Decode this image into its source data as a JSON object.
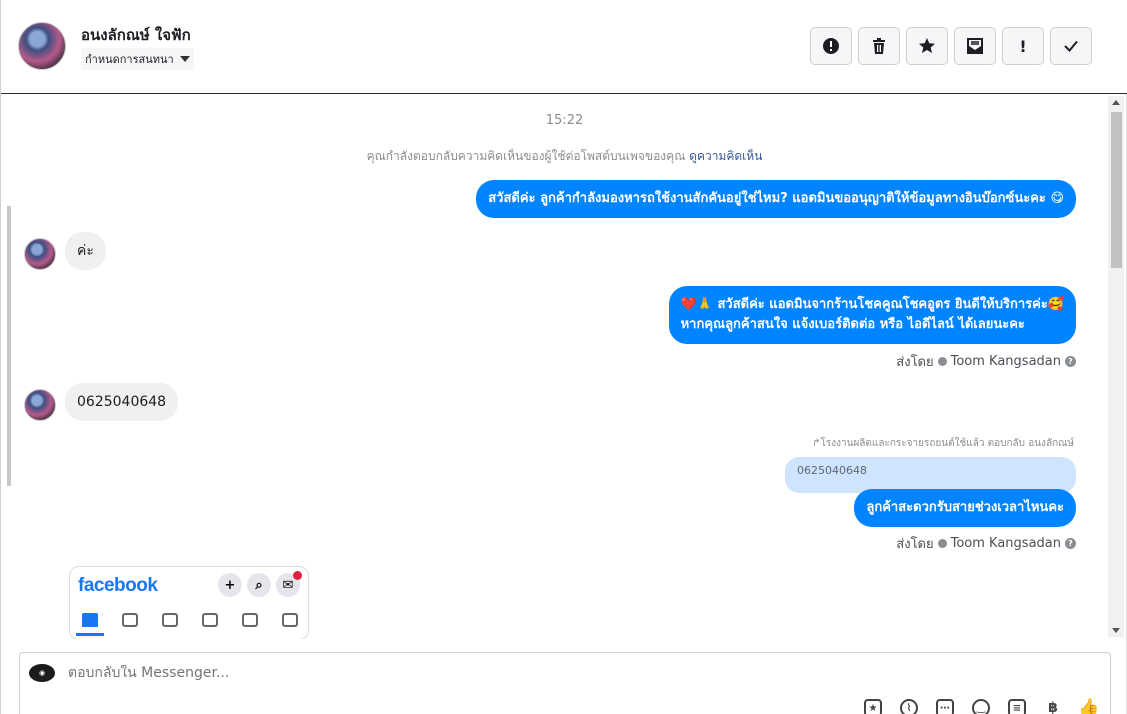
{
  "header": {
    "contact_name": "อนงลักณษ์ ใจฟัก",
    "conversation_dropdown": "กำหนดการสนทนา",
    "toolbar": [
      {
        "icon": "alert-circle-icon",
        "glyph": "!"
      },
      {
        "icon": "trash-icon",
        "glyph": "🗑"
      },
      {
        "icon": "star-icon",
        "glyph": "★"
      },
      {
        "icon": "archive-icon",
        "glyph": "⊠"
      },
      {
        "icon": "exclamation-icon",
        "glyph": "!"
      },
      {
        "icon": "checkmark-icon",
        "glyph": "✓"
      }
    ]
  },
  "thread": {
    "timestamp": "15:22",
    "context_note": "คุณกำลังตอบกลับความคิดเห็นของผู้ใช้ต่อโพสต์บนเพจของคุณ",
    "context_link": "ดูความคิดเห็น",
    "messages": {
      "out1": "สวัสดีค่ะ ลูกค้ากำลังมองหารถใช้งานสักคันอยู่ใช่ไหม? แอดมินขออนุญาติให้ข้อมูลทางอินบ๊อกซ์นะคะ 😋",
      "in1": "ค่ะ",
      "out2_line1": "❤️🙏 สวัสดีค่ะ แอดมินจากร้านโชคคูณโชคอูตร ยินดีให้บริการค่ะ🥰",
      "out2_line2": "หากคุณลูกค้าสนใจ แจ้งเบอร์ติดต่อ หรือ ไอดีไลน์ ได้เลยนะคะ",
      "sent_by_label": "ส่งโดย",
      "sent_by_name": "Toom Kangsadan",
      "in2": "0625040648",
      "reply_label": "↱โรงงานผลิตและกระจายรถยนต์ใช้แล้ว ตอบกลับ อนงลักณษ์",
      "quoted_text": "0625040648",
      "out3": "ลูกค้าสะดวกรับสายช่วงเวลาไหนคะ",
      "sent_by_label_2": "ส่งโดย",
      "sent_by_name_2": "Toom Kangsadan"
    },
    "attachment": {
      "brand": "facebook"
    }
  },
  "composer": {
    "placeholder": "ตอบกลับใน Messenger...",
    "tools": [
      "sticker-icon",
      "attach-icon",
      "quick-reply-icon",
      "emoji-icon",
      "saved-reply-icon",
      "currency-baht-icon",
      "like-icon"
    ]
  },
  "colors": {
    "outgoing_bubble": "#0084ff",
    "incoming_bubble": "#f0f0f0",
    "quoted_bubble": "#cfe4ff",
    "link": "#385898",
    "facebook_brand": "#1877f2"
  }
}
